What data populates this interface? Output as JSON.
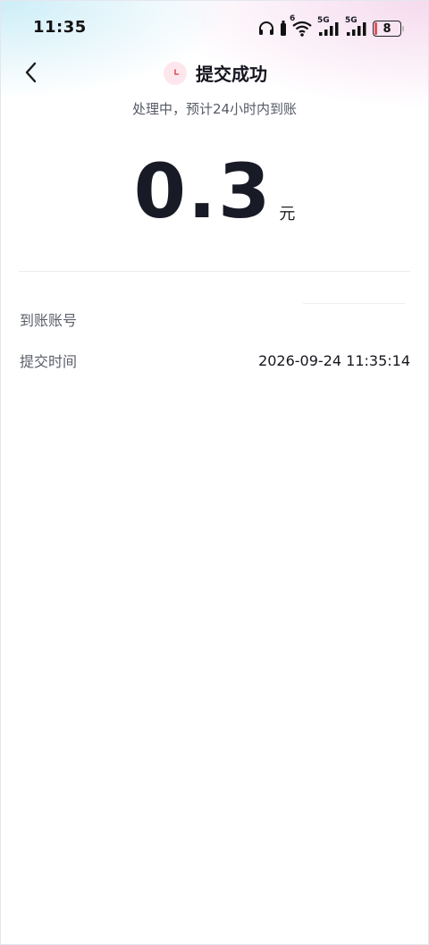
{
  "status_bar": {
    "time": "11:35",
    "network_1": "5G",
    "network_2": "5G",
    "wifi_badge": "6",
    "battery": "8",
    "battery_color": "#e0525b"
  },
  "header": {
    "back_icon": "chevron-left-icon",
    "status_icon": "clock-icon",
    "title": "提交成功",
    "subtitle": "处理中，预计24小时内到账"
  },
  "amount": {
    "value": "0.3",
    "unit": "元"
  },
  "details": [
    {
      "label": "到账账号",
      "value": ""
    },
    {
      "label": "提交时间",
      "value": "2026-09-24 11:35:14"
    }
  ],
  "colors": {
    "accent": "#e0525b",
    "text_primary": "#181a26",
    "text_secondary": "#5c5f6a"
  }
}
